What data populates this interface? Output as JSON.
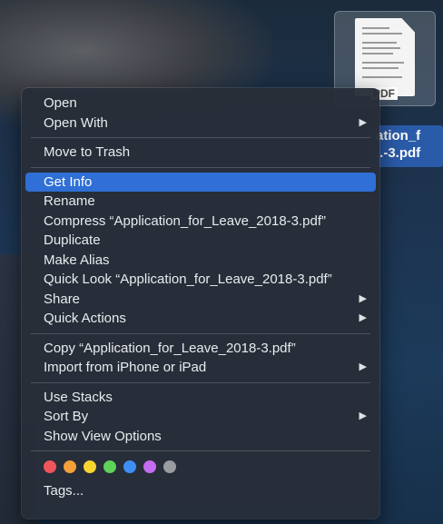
{
  "file": {
    "label_line1": "ation_f",
    "label_line2": "..-3.pdf",
    "thumbnail_badge": "PDF"
  },
  "menu": {
    "group1": [
      {
        "label": "Open",
        "submenu": false
      },
      {
        "label": "Open With",
        "submenu": true
      }
    ],
    "group2": [
      {
        "label": "Move to Trash",
        "submenu": false
      }
    ],
    "group3": [
      {
        "label": "Get Info",
        "submenu": false,
        "highlighted": true
      },
      {
        "label": "Rename",
        "submenu": false
      },
      {
        "label": "Compress “Application_for_Leave_2018-3.pdf”",
        "submenu": false
      },
      {
        "label": "Duplicate",
        "submenu": false
      },
      {
        "label": "Make Alias",
        "submenu": false
      },
      {
        "label": "Quick Look “Application_for_Leave_2018-3.pdf”",
        "submenu": false
      },
      {
        "label": "Share",
        "submenu": true
      },
      {
        "label": "Quick Actions",
        "submenu": true
      }
    ],
    "group4": [
      {
        "label": "Copy “Application_for_Leave_2018-3.pdf”",
        "submenu": false
      },
      {
        "label": "Import from iPhone or iPad",
        "submenu": true
      }
    ],
    "group5": [
      {
        "label": "Use Stacks",
        "submenu": false
      },
      {
        "label": "Sort By",
        "submenu": true
      },
      {
        "label": "Show View Options",
        "submenu": false
      }
    ],
    "submenu_arrow": "▶",
    "tag_colors": [
      "#f0555b",
      "#f5a03a",
      "#f6d531",
      "#5ed25a",
      "#3f8ef5",
      "#c56df0",
      "#9a9ca0"
    ],
    "tags_label": "Tags..."
  }
}
